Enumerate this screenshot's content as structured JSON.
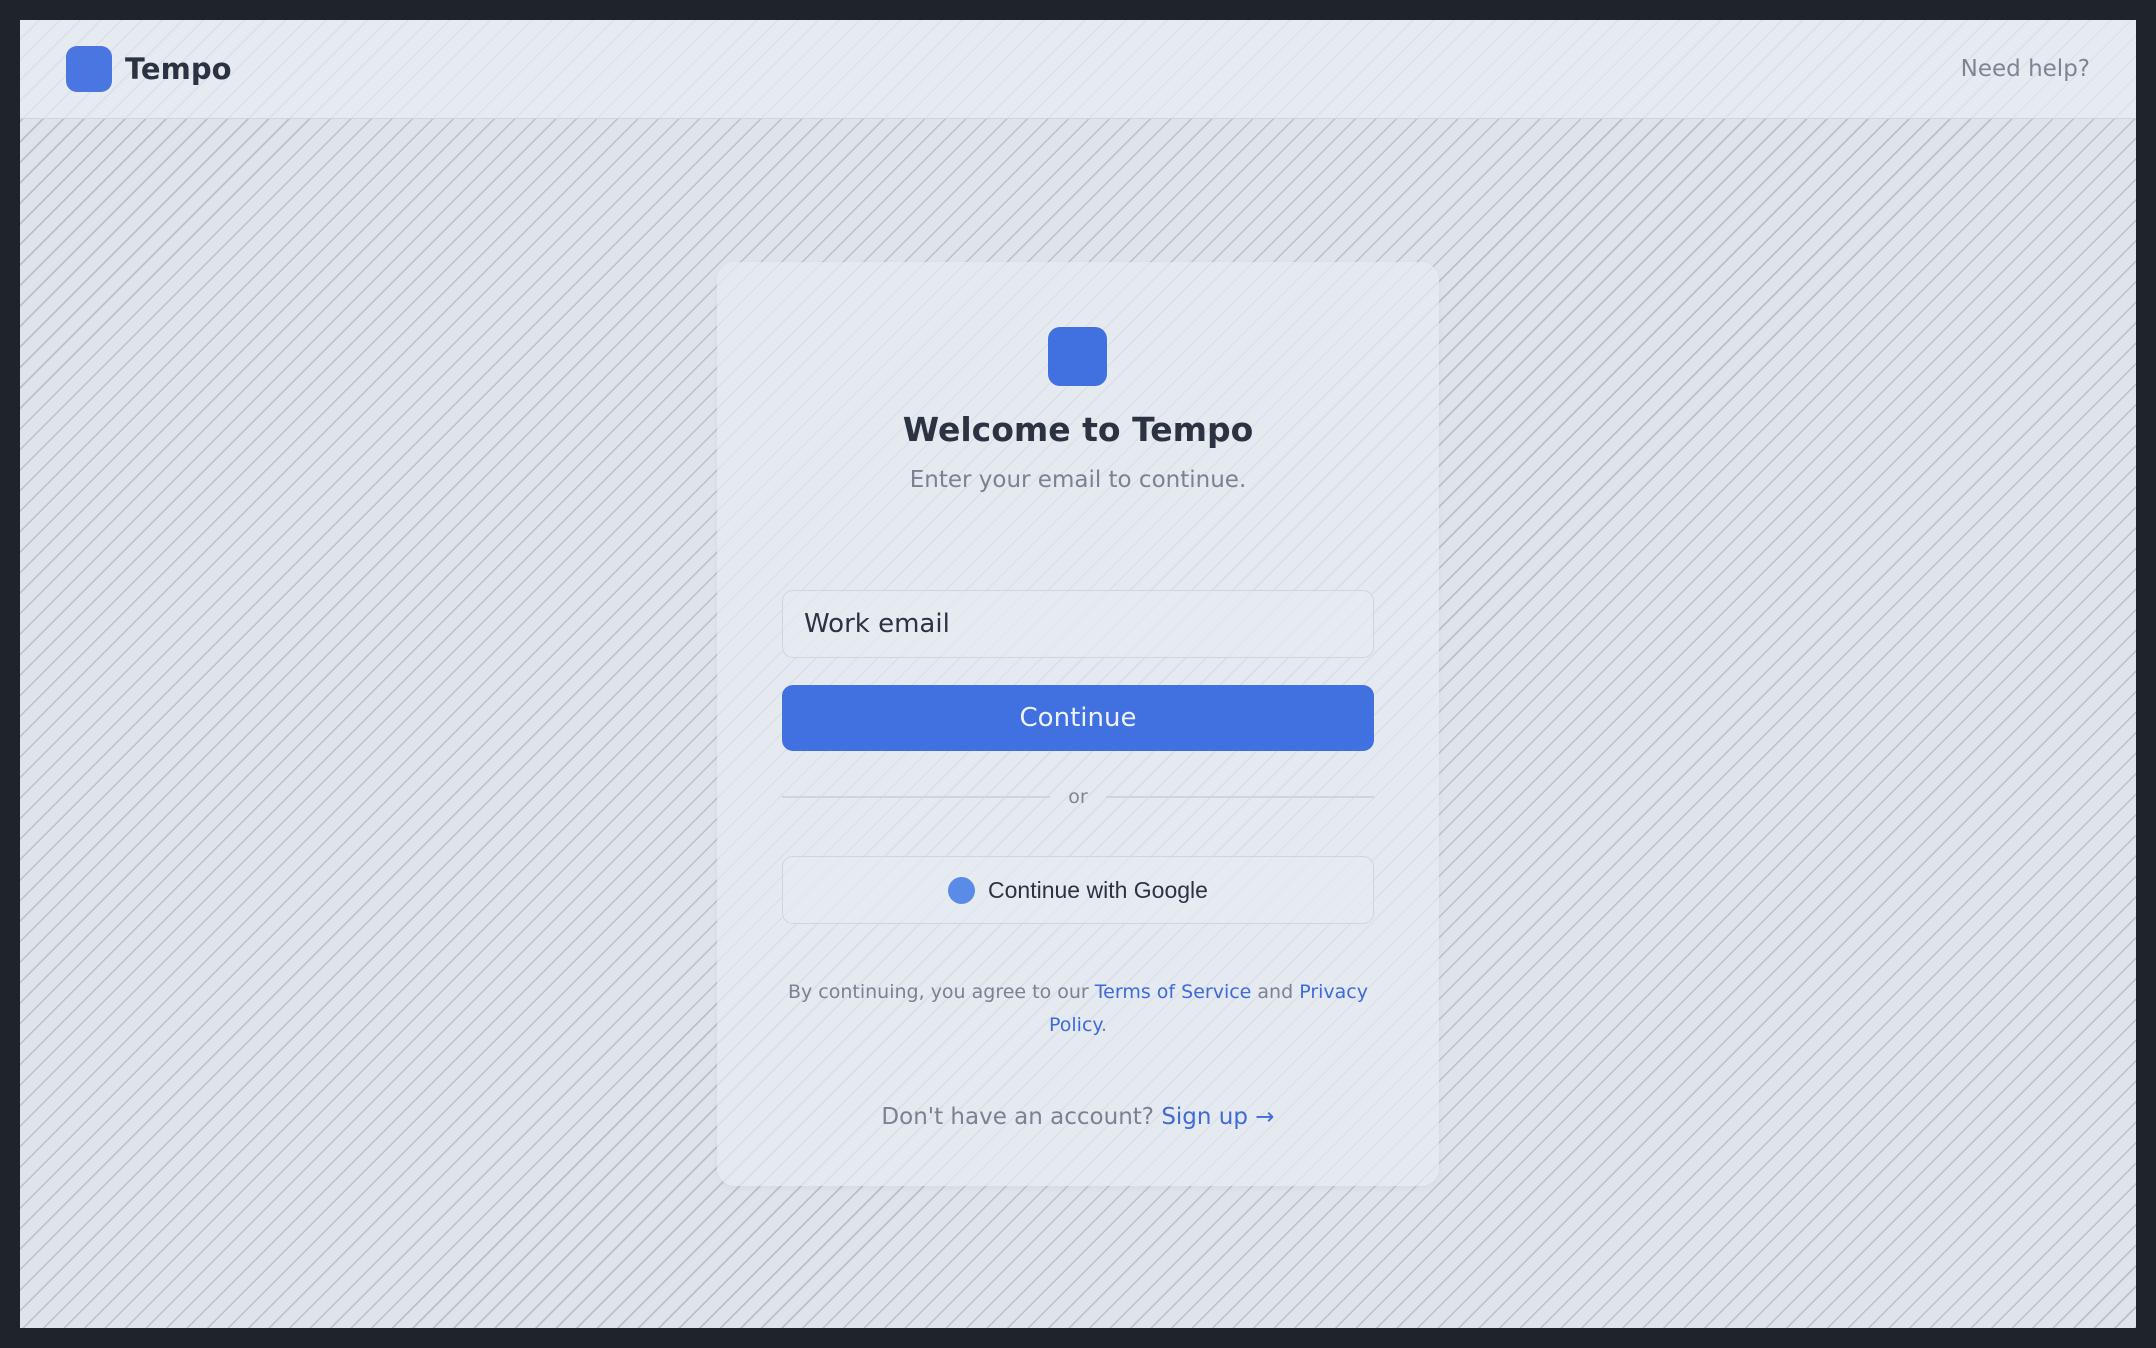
{
  "header": {
    "brand_name": "Tempo",
    "help_label": "Need help?"
  },
  "card": {
    "title": "Welcome to Tempo",
    "subtitle": "Enter your email to continue.",
    "email_placeholder": "Work email",
    "continue_label": "Continue",
    "divider_text": "or",
    "google_label": "Continue with Google",
    "legal": {
      "prefix": "By continuing, you agree to our ",
      "terms_label": "Terms of Service",
      "middle": " and ",
      "privacy_label": "Privacy Policy",
      "suffix": "."
    },
    "signup": {
      "prompt": "Don't have an account? ",
      "link_label": "Sign up →"
    }
  },
  "colors": {
    "accent": "#4170e0",
    "link": "#3d6bd8",
    "text_primary": "#2b3242",
    "text_muted": "#7a8291",
    "background": "#dfe3ea",
    "outer_frame": "#1f232b"
  },
  "icons": {
    "brand_logo": "brand-logo-icon",
    "card_logo": "app-logo-icon",
    "google": "google-icon"
  }
}
